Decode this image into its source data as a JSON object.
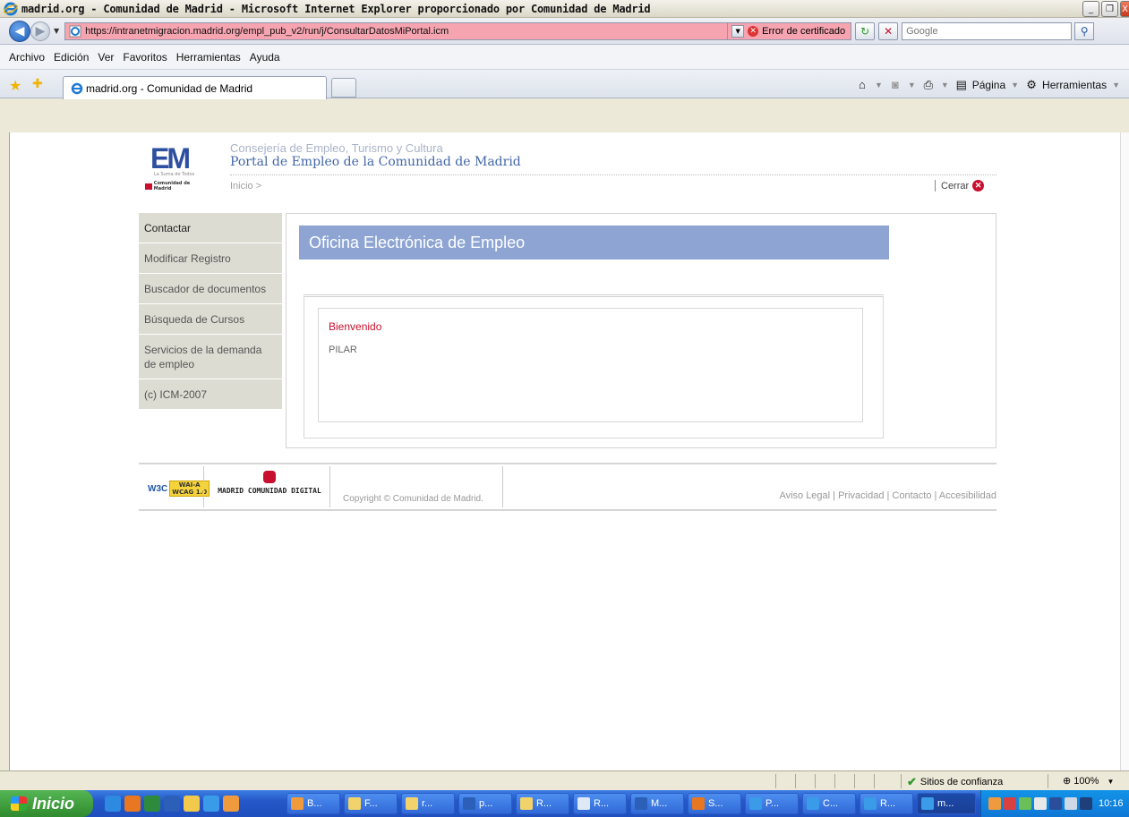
{
  "window": {
    "title": "madrid.org - Comunidad de Madrid - Microsoft Internet Explorer proporcionado por Comunidad de Madrid",
    "minimize_glyph": "_",
    "restore_glyph": "❐",
    "close_glyph": "X"
  },
  "address_bar": {
    "url": "https://intranetmigracion.madrid.org/empl_pub_v2/run/j/ConsultarDatosMiPortal.icm",
    "cert_error": "Error de certificado",
    "search_placeholder": "Google",
    "url_bg_color": "#f6a4b0"
  },
  "menu": {
    "items": [
      "Archivo",
      "Edición",
      "Ver",
      "Favoritos",
      "Herramientas",
      "Ayuda"
    ]
  },
  "tabs": {
    "active_label": "madrid.org - Comunidad de Madrid",
    "page_menu": "Página",
    "tools_menu": "Herramientas"
  },
  "page": {
    "logo_letters": "EM",
    "logo_tagline": "La Suma de Todos",
    "logo_org": "Comunidad de Madrid",
    "header_subtitle": "Consejería de Empleo, Turismo y Cultura",
    "header_title": "Portal de Empleo de la Comunidad de Madrid",
    "breadcrumb": "Inicio >",
    "close_label": "Cerrar",
    "left_menu": [
      "Contactar",
      "Modificar Registro",
      "Buscador de documentos",
      "Búsqueda de Cursos",
      "Servicios de la demanda de empleo",
      "(c) ICM-2007"
    ],
    "banner_title": "Oficina Electrónica de Empleo",
    "welcome": "Bienvenido",
    "user_name": "PILAR",
    "banner_color": "#8ea5d4",
    "accent_red": "#c8102e"
  },
  "footer": {
    "w3c_label": "W3C",
    "wai_label": "WAI-A",
    "wcag_label": "WCAG 1.0",
    "mcd_label": "MADRID COMUNIDAD DIGITAL",
    "copyright": "Copyright © Comunidad de Madrid.",
    "links": "Aviso Legal | Privacidad | Contacto | Accesibilidad"
  },
  "status_bar": {
    "zone": "Sitios de confianza",
    "zoom": "100%"
  },
  "taskbar": {
    "start_label": "Inicio",
    "buttons": [
      "B...",
      "F...",
      "r...",
      "p...",
      "R...",
      "R...",
      "M...",
      "S...",
      "P...",
      "C...",
      "R...",
      "m..."
    ],
    "clock": "10:16"
  }
}
